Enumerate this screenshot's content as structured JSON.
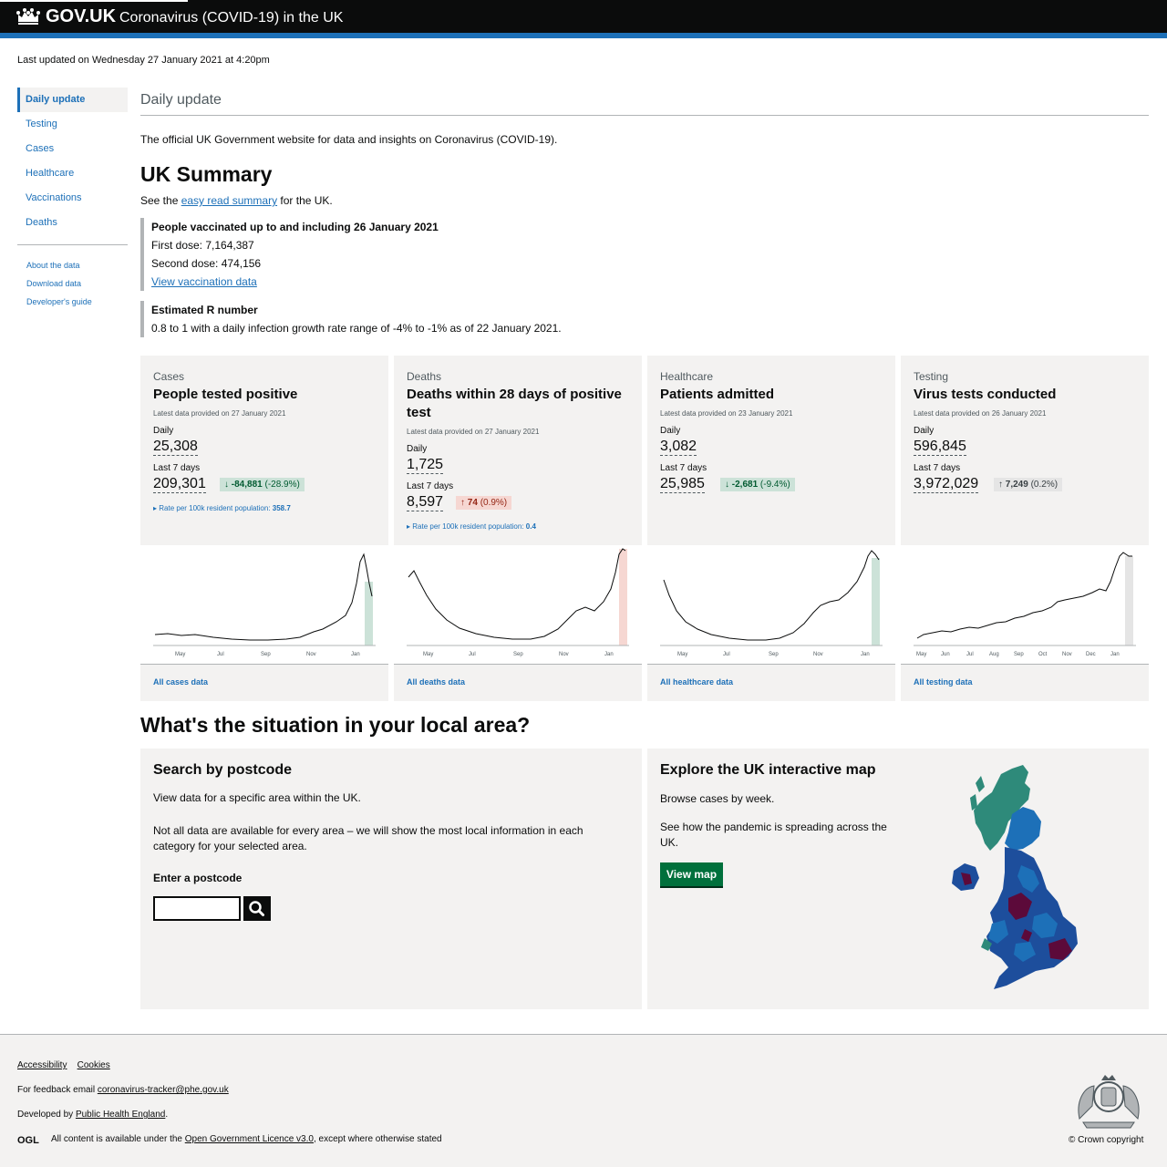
{
  "header": {
    "logo": "GOV.UK",
    "service": "Coronavirus (COVID-19) in the UK",
    "logo_icon": "crown-icon"
  },
  "last_updated": "Last updated on Wednesday 27 January 2021 at 4:20pm",
  "sidebar": {
    "items": [
      {
        "label": "Daily update"
      },
      {
        "label": "Testing"
      },
      {
        "label": "Cases"
      },
      {
        "label": "Healthcare"
      },
      {
        "label": "Vaccinations"
      },
      {
        "label": "Deaths"
      }
    ],
    "links": [
      {
        "label": "About the data"
      },
      {
        "label": "Download data"
      },
      {
        "label": "Developer's guide"
      }
    ]
  },
  "main": {
    "heading": "Daily update",
    "intro": "The official UK Government website for data and insights on Coronavirus (COVID-19).",
    "summary_title": "UK Summary",
    "see_pre": "See the ",
    "see_link": "easy read summary",
    "see_post": " for the UK."
  },
  "vaccination": {
    "title": "People vaccinated up to and including 26 January 2021",
    "first": "First dose: 7,164,387",
    "second": "Second dose: 474,156",
    "link": "View vaccination data"
  },
  "rnumber": {
    "title": "Estimated R number",
    "text": "0.8 to 1 with a daily infection growth rate range of -4% to -1% as of 22 January 2021."
  },
  "cards": [
    {
      "category": "Cases",
      "title": "People tested positive",
      "provided": "Latest data provided on 27 January 2021",
      "daily_label": "Daily",
      "daily": "25,308",
      "week_label": "Last 7 days",
      "week": "209,301",
      "change_arrow": "↓",
      "change": "-84,881",
      "change_pct": "(-28.9%)",
      "direction": "down",
      "rate_label": "Rate per 100k resident population: ",
      "rate": "358.7",
      "months": [
        "May",
        "Jul",
        "Sep",
        "Nov",
        "Jan"
      ],
      "link": "All cases data",
      "highlight": "#cce2d8",
      "highlight_stroke": "#00703c"
    },
    {
      "category": "Deaths",
      "title": "Deaths within 28 days of positive test",
      "provided": "Latest data provided on 27 January 2021",
      "daily_label": "Daily",
      "daily": "1,725",
      "week_label": "Last 7 days",
      "week": "8,597",
      "change_arrow": "↑",
      "change": "74",
      "change_pct": "(0.9%)",
      "direction": "up",
      "rate_label": "Rate per 100k resident population: ",
      "rate": "0.4",
      "months": [
        "May",
        "Jul",
        "Sep",
        "Nov",
        "Jan"
      ],
      "link": "All deaths data",
      "highlight": "#f6d7d2",
      "highlight_stroke": "#d4351c"
    },
    {
      "category": "Healthcare",
      "title": "Patients admitted",
      "provided": "Latest data provided on 23 January 2021",
      "daily_label": "Daily",
      "daily": "3,082",
      "week_label": "Last 7 days",
      "week": "25,985",
      "change_arrow": "↓",
      "change": "-2,681",
      "change_pct": "(-9.4%)",
      "direction": "down",
      "months": [
        "May",
        "Jul",
        "Sep",
        "Nov",
        "Jan"
      ],
      "link": "All healthcare data",
      "highlight": "#cce2d8",
      "highlight_stroke": "#00703c"
    },
    {
      "category": "Testing",
      "title": "Virus tests conducted",
      "provided": "Latest data provided on 26 January 2021",
      "daily_label": "Daily",
      "daily": "596,845",
      "week_label": "Last 7 days",
      "week": "3,972,029",
      "change_arrow": "↑",
      "change": "7,249",
      "change_pct": "(0.2%)",
      "direction": "flat",
      "months": [
        "May",
        "Jun",
        "Jul",
        "Aug",
        "Sep",
        "Oct",
        "Nov",
        "Dec",
        "Jan"
      ],
      "link": "All testing data",
      "highlight": "#e5e5e5",
      "highlight_stroke": "#b1b4b6"
    }
  ],
  "local": {
    "heading": "What's the situation in your local area?",
    "search_title": "Search by postcode",
    "search_text1": "View data for a specific area within the UK.",
    "search_text2": "Not all data are available for every area – we will show the most local information in each category for your selected area.",
    "postcode_label": "Enter a postcode",
    "map_title": "Explore the UK interactive map",
    "map_text1": "Browse cases by week.",
    "map_text2": "See how the pandemic is spreading across the UK.",
    "map_button": "View map"
  },
  "footer": {
    "accessibility": "Accessibility",
    "cookies": "Cookies",
    "feedback_pre": "For feedback email ",
    "feedback_email": "coronavirus-tracker@phe.gov.uk",
    "developed_pre": "Developed by ",
    "developed_link": "Public Health England",
    "developed_post": ".",
    "licence_pre": "All content is available under the ",
    "licence_link": "Open Government Licence v3.0",
    "licence_post": ", except where otherwise stated",
    "copyright": "© Crown copyright",
    "ogl": "OGL"
  }
}
